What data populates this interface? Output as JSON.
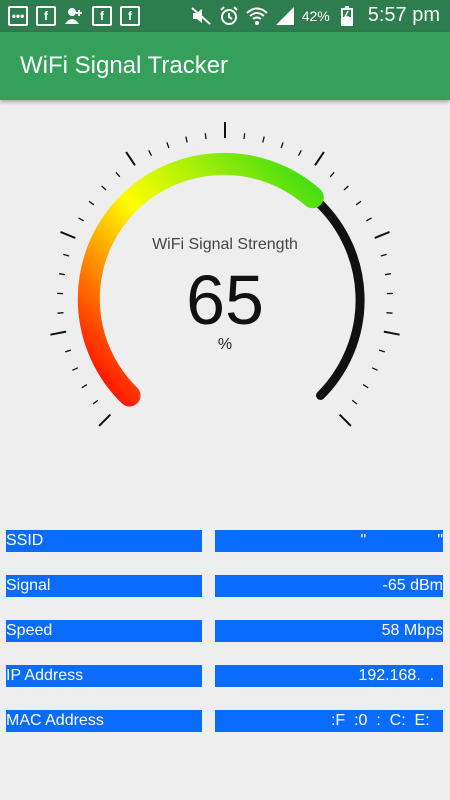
{
  "status_bar": {
    "battery_percent": "42%",
    "time": "5:57 pm",
    "left_icons": [
      "chat-icon",
      "facebook-icon",
      "add-friend-icon",
      "facebook-icon",
      "facebook-icon"
    ],
    "right_icons": [
      "mute-icon",
      "alarm-icon",
      "wifi-icon",
      "signal-icon",
      "battery-charging-icon"
    ]
  },
  "app_bar": {
    "title": "WiFi Signal Tracker"
  },
  "gauge": {
    "label": "WiFi Signal Strength",
    "value": 65,
    "value_text": "65",
    "unit": "%",
    "min": 0,
    "max": 100,
    "colors": {
      "low": "#ff0000",
      "mid": "#ffff00",
      "high": "#44dd11",
      "remaining": "#111111"
    }
  },
  "info": {
    "rows": [
      {
        "label": "SSID",
        "value": "\"                \""
      },
      {
        "label": "Signal",
        "value": "-65 dBm"
      },
      {
        "label": "Speed",
        "value": "58 Mbps"
      },
      {
        "label": "IP Address",
        "value": "192.168.  .  "
      },
      {
        "label": "MAC Address",
        "value": ":F  :0  :  C:  E:   "
      }
    ],
    "cell_color": "#0a6cff"
  }
}
